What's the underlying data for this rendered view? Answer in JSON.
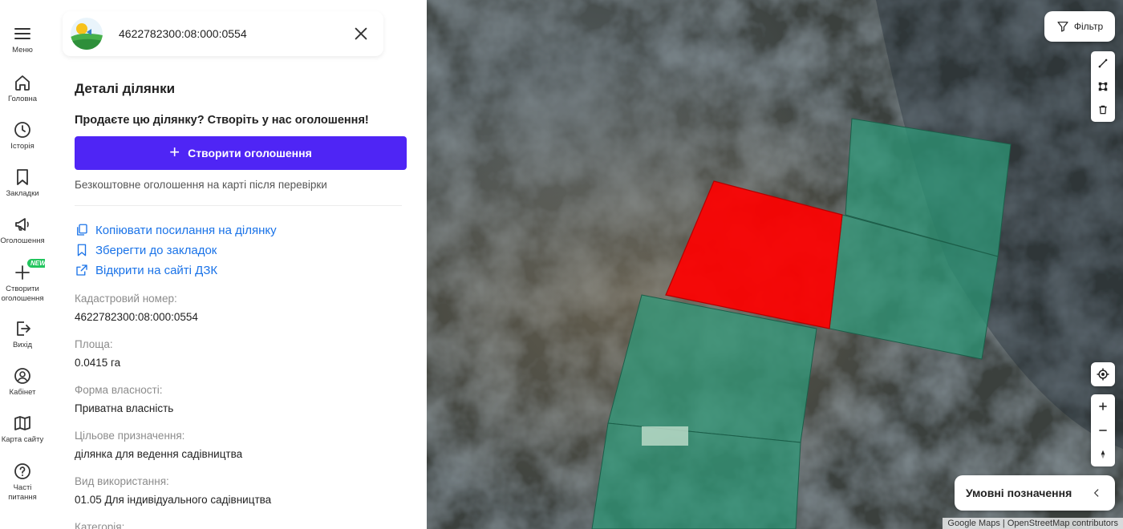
{
  "nav": {
    "items": [
      {
        "label": "Меню"
      },
      {
        "label": "Головна"
      },
      {
        "label": "Історія"
      },
      {
        "label": "Закладки"
      },
      {
        "label": "Оголошення"
      },
      {
        "label": "Створити оголошення",
        "badge": "NEW"
      },
      {
        "label": "Вихід"
      },
      {
        "label": "Кабінет"
      },
      {
        "label": "Карта сайту"
      },
      {
        "label": "Часті питання"
      }
    ]
  },
  "header": {
    "title": "4622782300:08:000:0554"
  },
  "details": {
    "section_title": "Деталі ділянки",
    "promo_text": "Продаєте цю ділянку? Створіть у нас оголошення!",
    "create_button": "Створити оголошення",
    "note": "Безкоштовне оголошення на карті після перевірки",
    "links": [
      {
        "label": "Копіювати посилання на ділянку",
        "icon": "copy-icon"
      },
      {
        "label": "Зберегти до закладок",
        "icon": "bookmark-icon"
      },
      {
        "label": "Відкрити на сайті ДЗК",
        "icon": "external-link-icon"
      }
    ],
    "fields": [
      {
        "label": "Кадастровий номер:",
        "value": "4622782300:08:000:0554"
      },
      {
        "label": "Площа:",
        "value": "0.0415 га"
      },
      {
        "label": "Форма власності:",
        "value": "Приватна власність"
      },
      {
        "label": "Цільове призначення:",
        "value": "ділянка для ведення садівництва"
      },
      {
        "label": "Вид використання:",
        "value": "01.05 Для індивідуального садівництва"
      },
      {
        "label": "Категорія:",
        "value": ""
      }
    ]
  },
  "map": {
    "filter_label": "Фільтр",
    "legend_label": "Умовні позначення",
    "attribution": "Google Maps | OpenStreetMap contributors",
    "colors": {
      "selected_parcel": "#ff0000",
      "parcel": "#2e9b7a",
      "accent": "#4f25f5",
      "link": "#1a73e8"
    }
  }
}
